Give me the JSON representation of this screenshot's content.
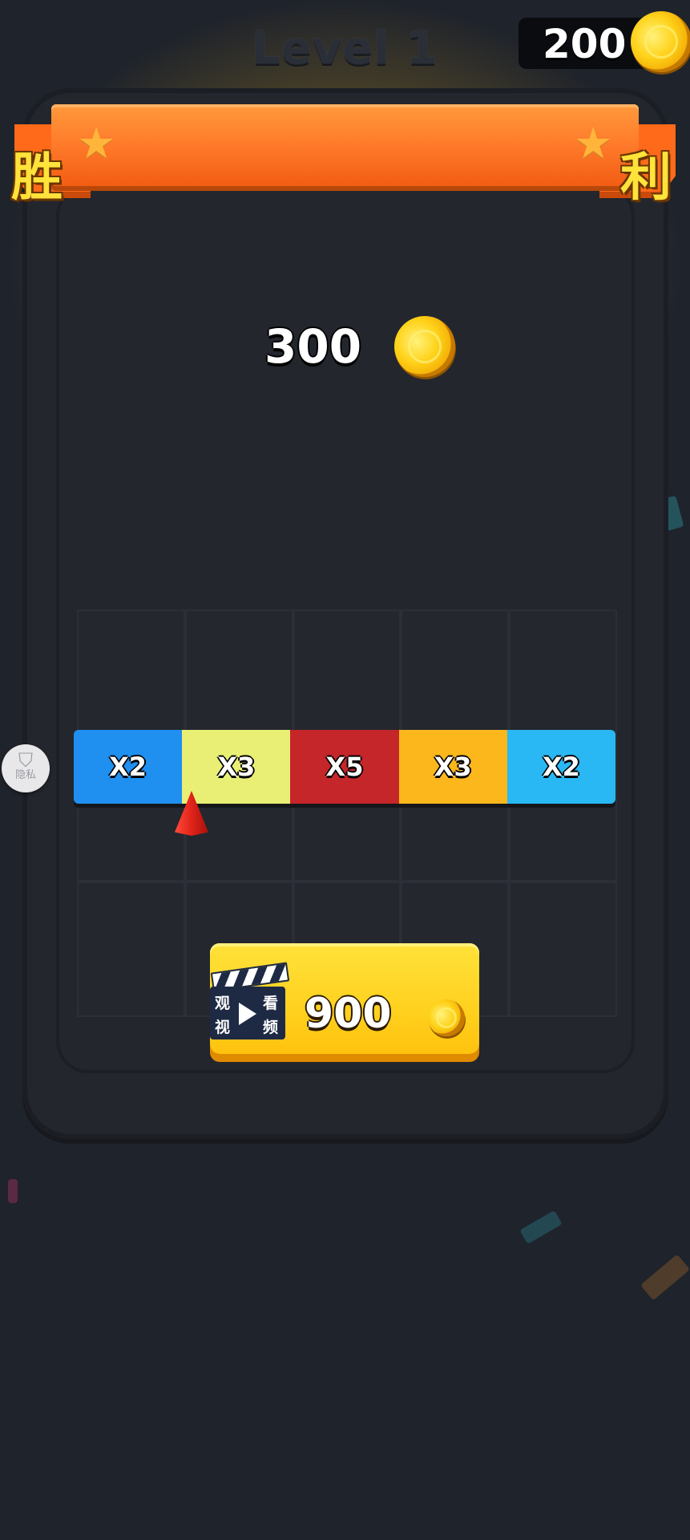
{
  "header": {
    "level_title": "Level 1",
    "coin_balance": "200"
  },
  "victory_banner": {
    "left_char": "胜",
    "right_char": "利"
  },
  "reward": {
    "amount": "300"
  },
  "multiplier_bar": {
    "segments": [
      {
        "label": "X2",
        "color": "#1f8ff0"
      },
      {
        "label": "X3",
        "color": "#e9ef74"
      },
      {
        "label": "X5",
        "color": "#c4262a"
      },
      {
        "label": "X3",
        "color": "#fbb71c"
      },
      {
        "label": "X2",
        "color": "#2ab8f4"
      }
    ],
    "pointer_segment_index": 1
  },
  "privacy_badge": {
    "label": "隐私"
  },
  "video_button": {
    "clapper_chars": [
      "观",
      "看",
      "视",
      "频"
    ],
    "price": "900"
  },
  "colors": {
    "banner": "#ff7a2a",
    "button": "#ffd11f",
    "background": "#1f232b"
  }
}
